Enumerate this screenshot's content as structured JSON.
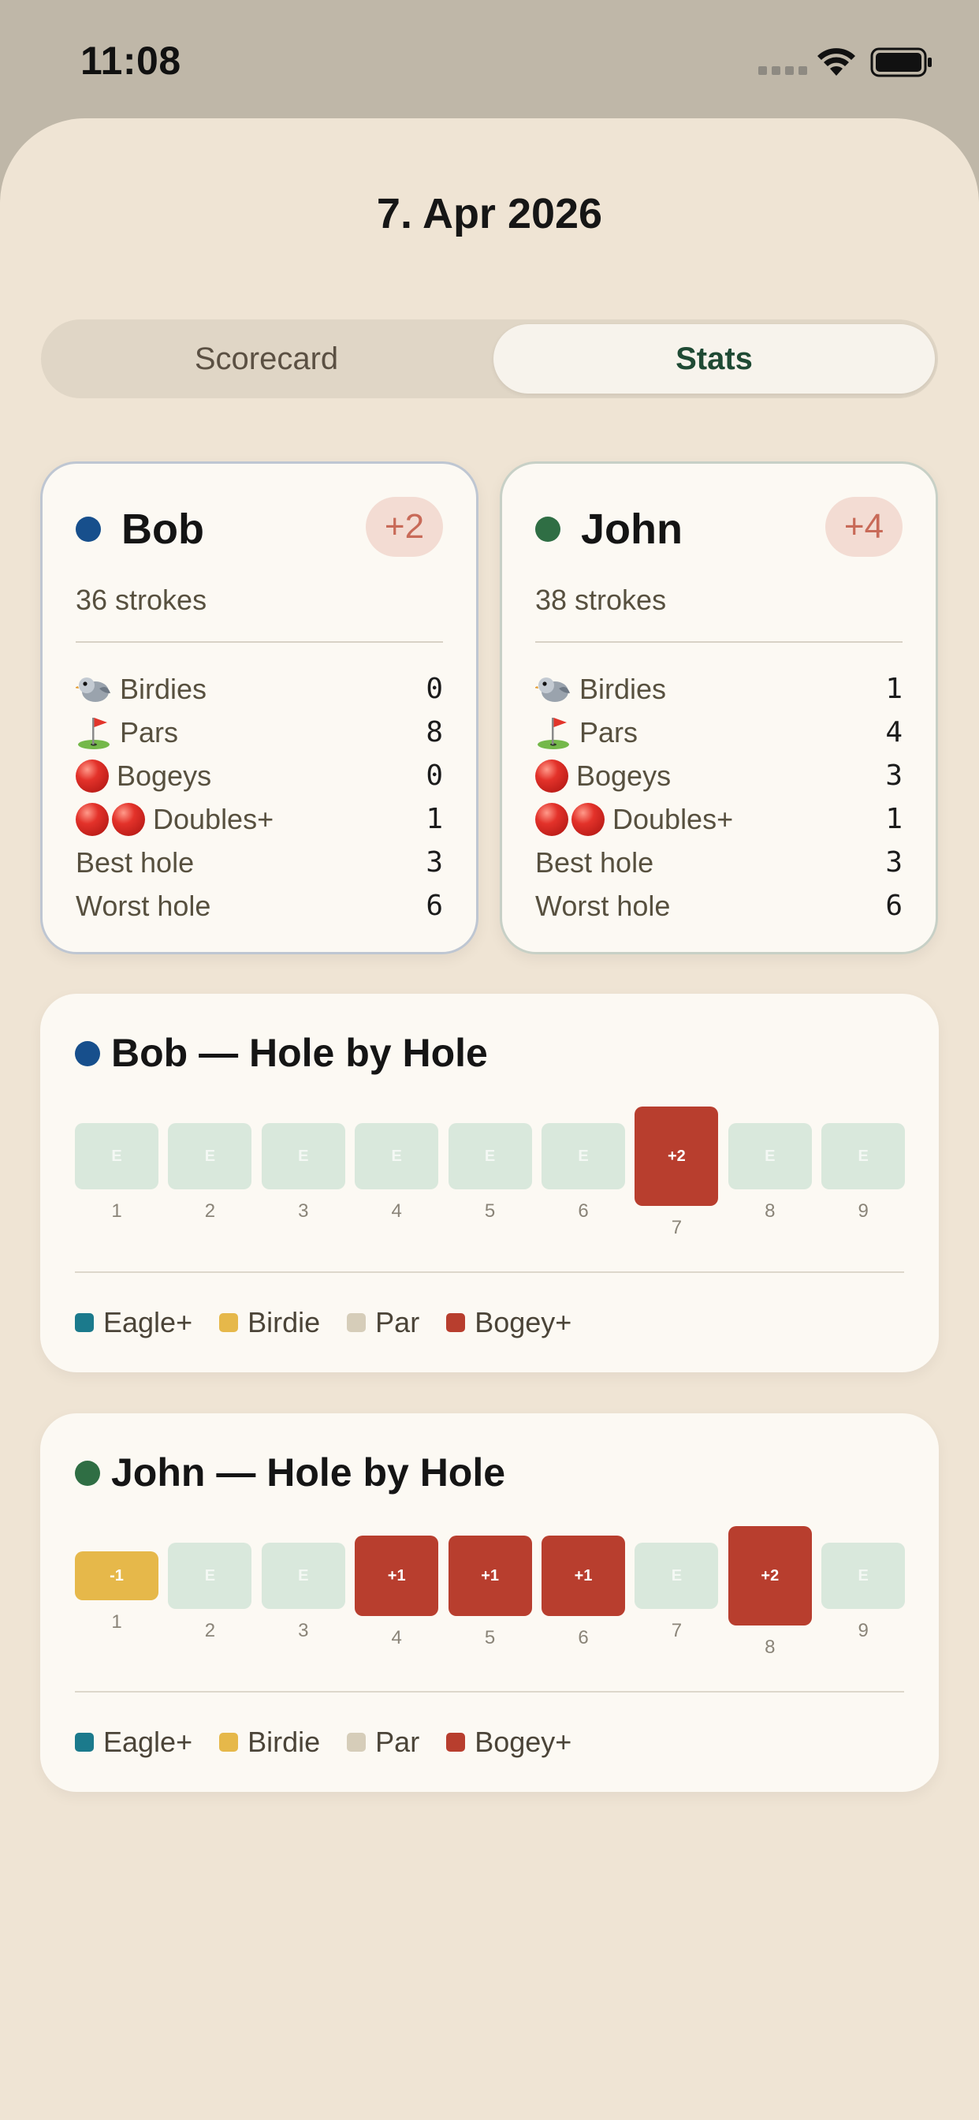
{
  "status_bar": {
    "time": "11:08"
  },
  "header": {
    "date": "7. Apr 2026"
  },
  "tabs": [
    {
      "label": "Scorecard",
      "selected": false
    },
    {
      "label": "Stats",
      "selected": true
    }
  ],
  "players": [
    {
      "name": "Bob",
      "color": "#174f8c",
      "score": "+2",
      "strokes": "36 strokes",
      "stats": [
        {
          "icon": "bird-icon",
          "label": "Birdies",
          "value": "0"
        },
        {
          "icon": "golf-flag-icon",
          "label": "Pars",
          "value": "8"
        },
        {
          "icon": "red-circle-icon",
          "label": "Bogeys",
          "value": "0"
        },
        {
          "icon": "double-red-circle-icon",
          "label": "Doubles+",
          "value": "1"
        },
        {
          "icon": "",
          "label": "Best hole",
          "value": "3"
        },
        {
          "icon": "",
          "label": "Worst hole",
          "value": "6"
        }
      ]
    },
    {
      "name": "John",
      "color": "#2f6e44",
      "score": "+4",
      "strokes": "38 strokes",
      "stats": [
        {
          "icon": "bird-icon",
          "label": "Birdies",
          "value": "1"
        },
        {
          "icon": "golf-flag-icon",
          "label": "Pars",
          "value": "4"
        },
        {
          "icon": "red-circle-icon",
          "label": "Bogeys",
          "value": "3"
        },
        {
          "icon": "double-red-circle-icon",
          "label": "Doubles+",
          "value": "1"
        },
        {
          "icon": "",
          "label": "Best hole",
          "value": "3"
        },
        {
          "icon": "",
          "label": "Worst hole",
          "value": "6"
        }
      ]
    }
  ],
  "hole_by_hole": [
    {
      "title": "Bob — Hole by Hole",
      "color": "#174f8c",
      "holes": [
        {
          "number": "1",
          "label": "E",
          "relative": 0
        },
        {
          "number": "2",
          "label": "E",
          "relative": 0
        },
        {
          "number": "3",
          "label": "E",
          "relative": 0
        },
        {
          "number": "4",
          "label": "E",
          "relative": 0
        },
        {
          "number": "5",
          "label": "E",
          "relative": 0
        },
        {
          "number": "6",
          "label": "E",
          "relative": 0
        },
        {
          "number": "7",
          "label": "+2",
          "relative": 2
        },
        {
          "number": "8",
          "label": "E",
          "relative": 0
        },
        {
          "number": "9",
          "label": "E",
          "relative": 0
        }
      ]
    },
    {
      "title": "John — Hole by Hole",
      "color": "#2f6e44",
      "holes": [
        {
          "number": "1",
          "label": "-1",
          "relative": -1
        },
        {
          "number": "2",
          "label": "E",
          "relative": 0
        },
        {
          "number": "3",
          "label": "E",
          "relative": 0
        },
        {
          "number": "4",
          "label": "+1",
          "relative": 1
        },
        {
          "number": "5",
          "label": "+1",
          "relative": 1
        },
        {
          "number": "6",
          "label": "+1",
          "relative": 1
        },
        {
          "number": "7",
          "label": "E",
          "relative": 0
        },
        {
          "number": "8",
          "label": "+2",
          "relative": 2
        },
        {
          "number": "9",
          "label": "E",
          "relative": 0
        }
      ]
    }
  ],
  "legend": [
    {
      "label": "Eagle+",
      "color": "#1b7a8c"
    },
    {
      "label": "Birdie",
      "color": "#e6b84a"
    },
    {
      "label": "Par",
      "color": "#d6cdb9"
    },
    {
      "label": "Bogey+",
      "color": "#b83e2e"
    }
  ],
  "colors": {
    "par_box": "#d9e8dc",
    "par_text": "#f4f8f4",
    "birdie_box": "#e6b84a",
    "bogey_box": "#b83e2e"
  }
}
